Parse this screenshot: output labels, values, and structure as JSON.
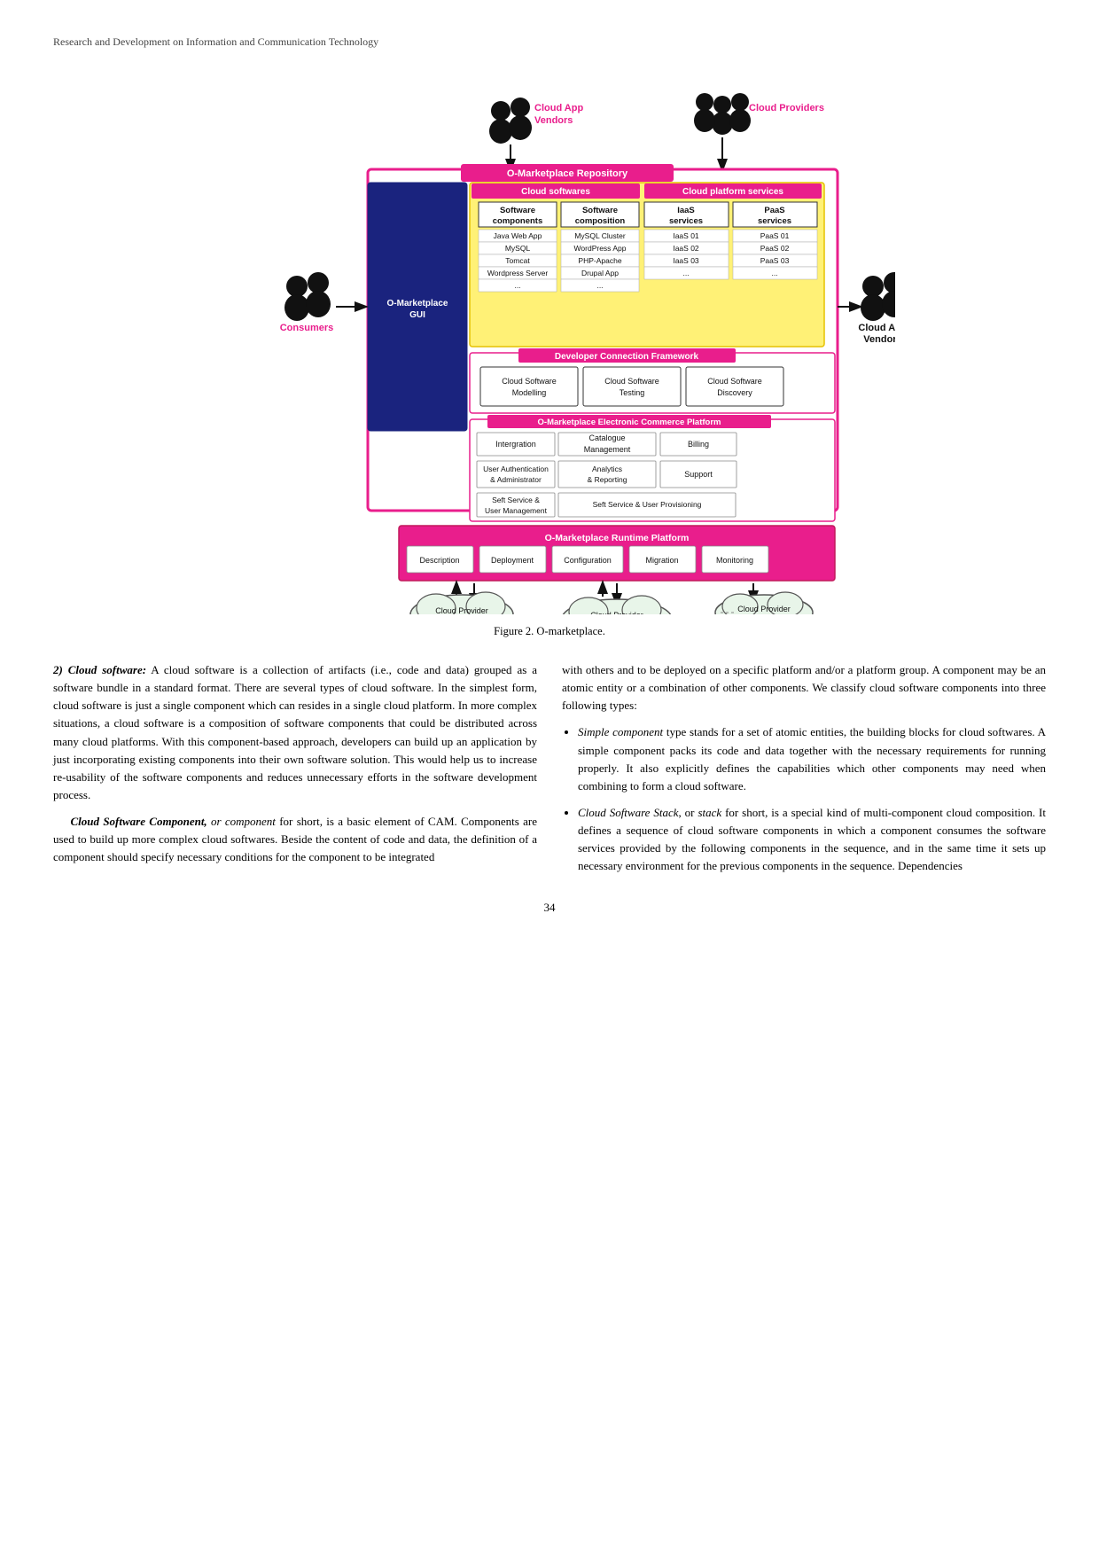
{
  "header": "Research and Development on Information and Communication Technology",
  "figure_caption": "Figure 2.  O-marketplace.",
  "page_number": "34",
  "diagram": {
    "cloud_app_vendors_top": "Cloud App\nVendors",
    "cloud_providers": "Cloud Providers",
    "o_marketplace_repo": "O-Marketplace Repository",
    "cloud_softwares": "Cloud softwares",
    "cloud_platform_services": "Cloud platform services",
    "software_components": "Software\ncomponents",
    "software_composition": "Software\ncomposition",
    "iaas_services": "IaaS\nservices",
    "paas_services": "PaaS\nservices",
    "sw_comp_items": [
      "Java Web App",
      "MySQL",
      "Tomcat",
      "Wordpress Server",
      "..."
    ],
    "sw_comp_items2": [
      "MySQL Cluster",
      "WordPress App",
      "PHP-Apache",
      "Drupal App",
      "..."
    ],
    "iaas_items": [
      "IaaS 01",
      "IaaS 02",
      "IaaS 03",
      "..."
    ],
    "paas_items": [
      "PaaS 01",
      "PaaS 02",
      "PaaS 03",
      "..."
    ],
    "o_marketplace_gui": "O-Marketplace\nGUI",
    "developer_connection": "Developer Connection Framework",
    "cloud_sw_modelling": "Cloud Software\nModelling",
    "cloud_sw_testing": "Cloud Software\nTesting",
    "cloud_sw_discovery": "Cloud Software\nDiscovery",
    "ecommerce_platform": "O-Marketplace Electronic Commerce Platform",
    "integration": "Intergration",
    "catalogue_management": "Catalogue\nManagement",
    "billing": "Billing",
    "user_auth": "User Authentication\n& Administrator",
    "analytics": "Analytics\n& Reporting",
    "support": "Support",
    "self_service": "Seft Service &\nUser Management",
    "self_service_provisioning": "Seft Service & User Provisioning",
    "runtime_platform": "O-Marketplace Runtime Platform",
    "description": "Description",
    "deployment": "Deployment",
    "configuration": "Configuration",
    "migration": "Migration",
    "monitoring": "Monitoring",
    "consumers": "Consumers",
    "cloud_app_vendors_right": "Cloud App\nVendors",
    "cloud_provider_a": "Cloud Provider\nA",
    "cloud_provider_b": "Cloud Provider\nB",
    "cloud_provider_c": "Cloud Provider\nC"
  },
  "body_left": {
    "section_label": "2) Cloud software:",
    "p1": "A cloud software is a collection of artifacts (i.e., code and data) grouped as a software bundle in a standard format. There are several types of cloud software. In the simplest form, cloud software is just a single component which can resides in a single cloud platform. In more complex situations, a cloud software is a composition of software components that could be distributed across many cloud platforms. With this component-based approach, developers can build up an application by just incorporating existing components into their own software solution. This would help us to increase re-usability of the software components and reduces unnecessary efforts in the software development process.",
    "p2_label": "Cloud Software Component,",
    "p2_italic": " or ",
    "p2_italic2": "component",
    "p2": " for short, is a basic element of CAM. Components are used to build up more complex cloud softwares. Beside the content of code and data, the definition of a component should specify necessary conditions for the component to be integrated"
  },
  "body_right": {
    "p1": "with others and to be deployed on a specific platform and/or a platform group. A component may be an atomic entity or a combination of other components. We classify cloud software components into three following types:",
    "bullet1_label": "Simple component",
    "bullet1": " type stands for a set of atomic entities, the building blocks for cloud softwares. A simple component packs its code and data together with the necessary requirements for running properly. It also explicitly defines the capabilities which other components may need when combining to form a cloud software.",
    "bullet2_label1": "Cloud Software Stack",
    "bullet2_label2": ", or ",
    "bullet2_label3": "stack",
    "bullet2": " for short, is a special kind of multi-component cloud composition. It defines a sequence of cloud software components in which a component consumes the software services provided by the following components in the sequence, and in the same time it sets up necessary environment for the previous components in the sequence. Dependencies"
  }
}
